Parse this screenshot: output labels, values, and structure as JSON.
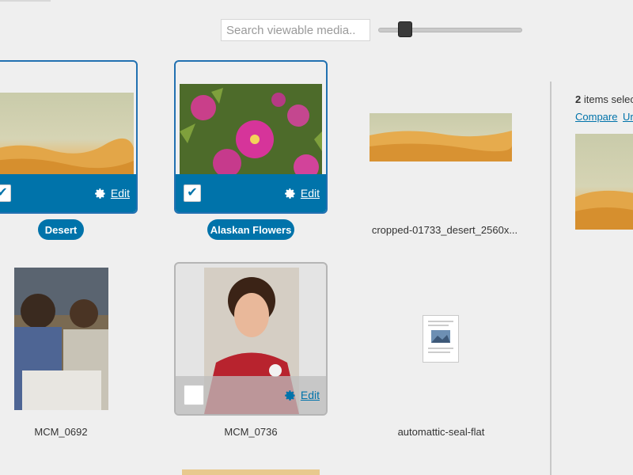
{
  "toolbar": {
    "search_placeholder": "Search viewable media..",
    "zoom_level": 0.15
  },
  "media_items": [
    {
      "title": "Desert",
      "selected": true,
      "checkmark": "✔",
      "edit_label": "Edit"
    },
    {
      "title": "Alaskan Flowers",
      "selected": true,
      "checkmark": "✔",
      "edit_label": "Edit"
    },
    {
      "title": "cropped-01733_desert_2560x...",
      "selected": false
    },
    {
      "title": "MCM_0692",
      "selected": false
    },
    {
      "title": "MCM_0736",
      "selected": false,
      "hovered": true,
      "edit_label": "Edit"
    },
    {
      "title": "automattic-seal-flat",
      "selected": false
    }
  ],
  "sidebar": {
    "count": "2",
    "count_suffix": " items selec",
    "compare_label": "Compare",
    "second_link_label": "Ur"
  },
  "colors": {
    "accent": "#0073aa",
    "selected_border": "#2271b1",
    "background": "#efefef"
  },
  "icons": {
    "edit": "gear-icon",
    "selected": "checkmark-icon"
  }
}
